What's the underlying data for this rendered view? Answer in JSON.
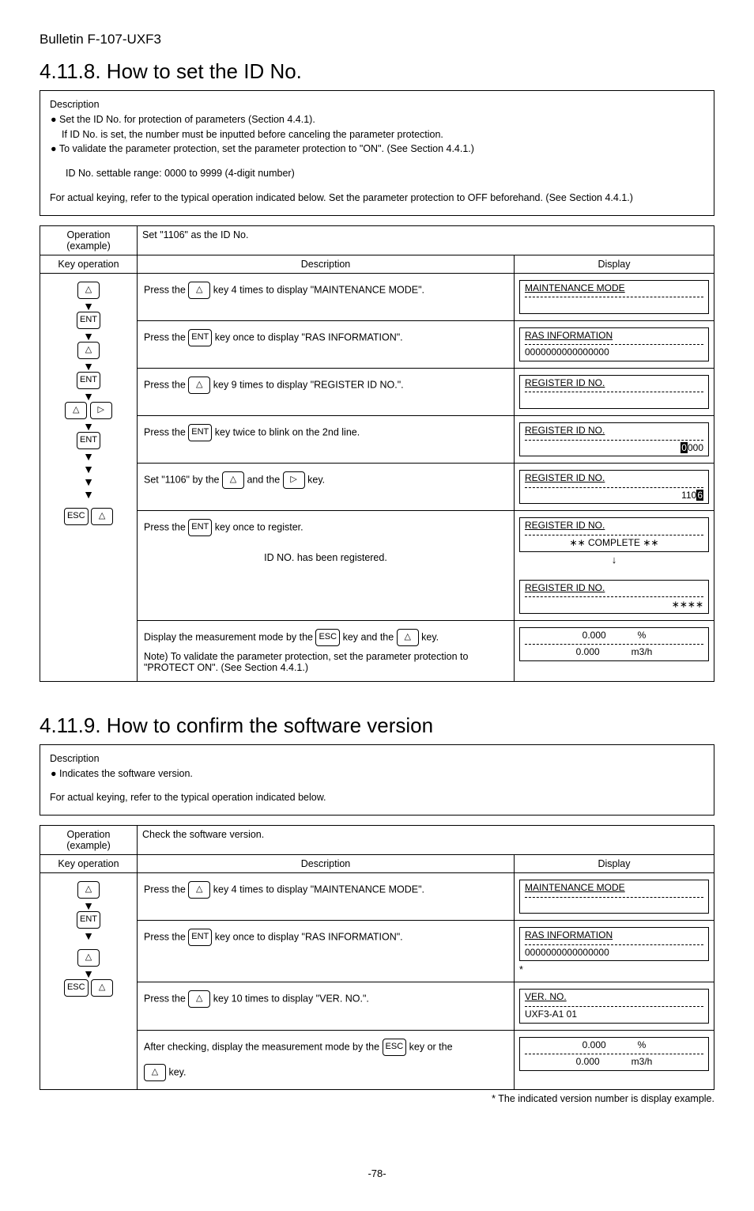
{
  "bulletin": "Bulletin F-107-UXF3",
  "section8": {
    "heading": "4.11.8. How to set the ID No.",
    "desc_title": "Description",
    "bullets": [
      "Set the ID No. for protection of parameters (Section 4.4.1).",
      "To validate the parameter protection, set the parameter protection to \"ON\". (See Section 4.4.1.)"
    ],
    "bullet1_sub": "If ID No. is set, the number must be inputted before canceling the parameter protection.",
    "range": "ID No. settable range: 0000 to 9999 (4-digit number)",
    "actual": "For actual keying, refer to the typical operation indicated below. Set the parameter protection to OFF beforehand. (See Section 4.4.1.)",
    "op_example_hdr": "Operation (example)",
    "op_example": "Set \"1106\" as the ID No.",
    "col_key": "Key operation",
    "col_desc": "Description",
    "col_disp": "Display",
    "steps": {
      "s1_pre": "Press the ",
      "s1_post": " key 4 times to display \"MAINTENANCE MODE\".",
      "d1_l1": "MAINTENANCE MODE",
      "s2_pre": "Press the ",
      "s2_mid": "ENT",
      "s2_post": " key once to display \"RAS INFORMATION\".",
      "d2_l1": "RAS INFORMATION",
      "d2_l2": "0000000000000000",
      "s3_pre": "Press the ",
      "s3_post": " key 9 times to display \"REGISTER ID NO.\".",
      "d3_l1": "REGISTER ID NO.",
      "s4_pre": "Press the ",
      "s4_mid": "ENT",
      "s4_post": " key twice to blink on the 2nd line.",
      "d4_l1": "REGISTER ID NO.",
      "d4_r0": "0",
      "d4_rrest": "000",
      "s5_pre": "Set \"1106\" by the ",
      "s5_mid": " and the ",
      "s5_post": " key.",
      "d5_l1": "REGISTER ID NO.",
      "d5_pre": "110",
      "d5_hi": "6",
      "s6_pre": "Press the ",
      "s6_mid": "ENT",
      "s6_post": " key once to register.",
      "d6_l1": "REGISTER ID NO.",
      "d6_l2": "∗∗ COMPLETE ∗∗",
      "s6b": "ID NO. has been registered.",
      "d6b_l1": "REGISTER ID NO.",
      "d6b_l2": "∗∗∗∗",
      "s7_pre": "Display the measurement mode by the ",
      "s7_esc": "ESC",
      "s7_mid": " key and the ",
      "s7_post": " key.",
      "d7_v1": "0.000",
      "d7_u1": "%",
      "d7_v2": "0.000",
      "d7_u2": "m3/h",
      "note": "Note)  To validate the parameter protection, set the parameter protection to \"PROTECT ON\". (See Section 4.4.1.)"
    }
  },
  "section9": {
    "heading": "4.11.9. How to confirm the software version",
    "desc_title": "Description",
    "bullet": "Indicates the software version.",
    "actual": "For actual keying, refer to the typical operation indicated below.",
    "op_example_hdr": "Operation (example)",
    "op_example": "Check the software version.",
    "col_key": "Key operation",
    "col_desc": "Description",
    "col_disp": "Display",
    "steps": {
      "s1_pre": "Press the ",
      "s1_post": " key 4 times to display \"MAINTENANCE MODE\".",
      "d1_l1": "MAINTENANCE MODE",
      "s2_pre": "Press the ",
      "s2_mid": "ENT",
      "s2_post": " key once to display \"RAS INFORMATION\".",
      "d2_l1": "RAS INFORMATION",
      "d2_l2": "0000000000000000",
      "star": "*",
      "s3_pre": "Press the ",
      "s3_post": " key 10 times to display \"VER. NO.\".",
      "d3_l1": "VER. NO.",
      "d3_l2": "UXF3-A1   01",
      "s4_pre": "After checking, display the measurement mode by the ",
      "s4_esc": "ESC",
      "s4_mid": " key or the ",
      "s4_post": " key.",
      "d4_v1": "0.000",
      "d4_u1": "%",
      "d4_v2": "0.000",
      "d4_u2": "m3/h"
    },
    "footnote": "* The indicated version number is display example."
  },
  "page": "-78-"
}
